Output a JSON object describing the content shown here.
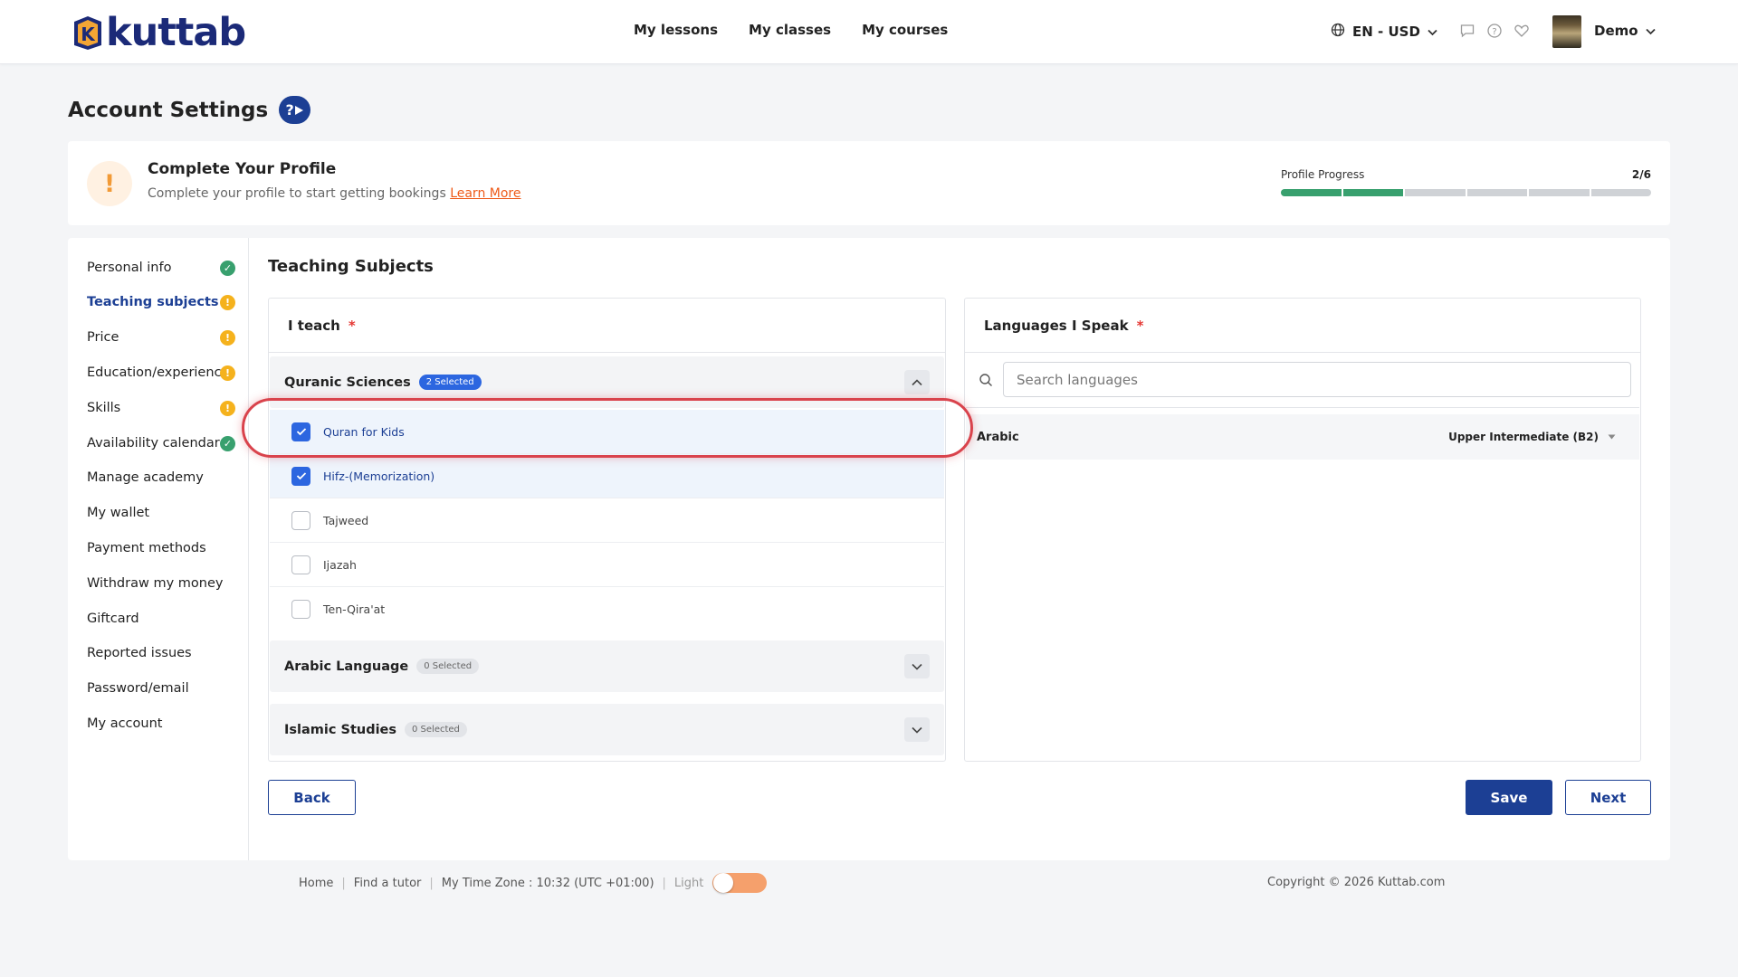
{
  "header": {
    "logo_text": "kuttab",
    "nav": [
      "My lessons",
      "My classes",
      "My courses"
    ],
    "lang_currency": "EN - USD",
    "user_name": "Demo"
  },
  "page": {
    "title": "Account Settings",
    "help_label": "?"
  },
  "profile": {
    "title": "Complete Your Profile",
    "subtitle": "Complete your profile to start getting bookings",
    "learn_more": "Learn More",
    "progress_label": "Profile Progress",
    "progress_count": "2/6",
    "progress_done": 2,
    "progress_total": 6,
    "accent": "#38a06e"
  },
  "sidebar": {
    "items": [
      {
        "label": "Personal info",
        "status": "ok"
      },
      {
        "label": "Teaching subjects",
        "status": "warn"
      },
      {
        "label": "Price",
        "status": "warn"
      },
      {
        "label": "Education/experience",
        "status": "warn"
      },
      {
        "label": "Skills",
        "status": "warn"
      },
      {
        "label": "Availability calendar",
        "status": "ok"
      },
      {
        "label": "Manage academy",
        "status": ""
      },
      {
        "label": "My wallet",
        "status": ""
      },
      {
        "label": "Payment methods",
        "status": ""
      },
      {
        "label": "Withdraw my money",
        "status": ""
      },
      {
        "label": "Giftcard",
        "status": ""
      },
      {
        "label": "Reported issues",
        "status": ""
      },
      {
        "label": "Password/email",
        "status": ""
      },
      {
        "label": "My account",
        "status": ""
      }
    ]
  },
  "main": {
    "section_title": "Teaching Subjects",
    "i_teach": {
      "label": "I teach",
      "required_mark": "*",
      "groups": [
        {
          "name": "Quranic Sciences",
          "badge": "2 Selected",
          "expanded": true,
          "options": [
            {
              "label": "Quran for Kids",
              "checked": true
            },
            {
              "label": "Hifz-(Memorization)",
              "checked": true
            },
            {
              "label": "Tajweed",
              "checked": false
            },
            {
              "label": "Ijazah",
              "checked": false
            },
            {
              "label": "Ten-Qira'at",
              "checked": false
            }
          ]
        },
        {
          "name": "Arabic Language",
          "badge": "0 Selected",
          "expanded": false
        },
        {
          "name": "Islamic Studies",
          "badge": "0 Selected",
          "expanded": false
        }
      ]
    },
    "languages": {
      "label": "Languages I Speak",
      "required_mark": "*",
      "search_placeholder": "Search languages",
      "items": [
        {
          "name": "Arabic",
          "level": "Upper Intermediate (B2)"
        }
      ]
    },
    "buttons": {
      "back": "Back",
      "save": "Save",
      "next": "Next"
    }
  },
  "footer": {
    "links": [
      "Home",
      "Find a tutor"
    ],
    "timezone": "My Time Zone : 10:32 (UTC +01:00)",
    "theme_label": "Light",
    "copyright": "Copyright © 2026 Kuttab.com"
  }
}
